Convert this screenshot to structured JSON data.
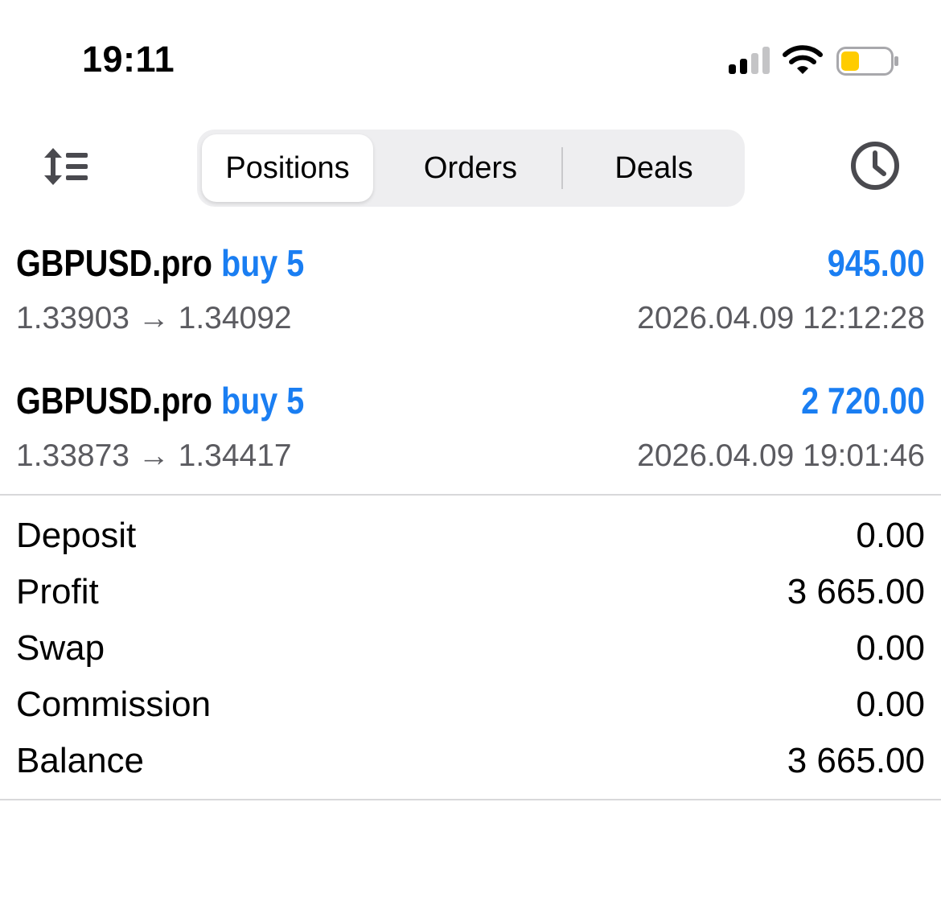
{
  "status_bar": {
    "time": "19:11",
    "icons": [
      "signal-icon",
      "wifi-icon",
      "battery-icon"
    ],
    "battery_color": "#ffcc00"
  },
  "toolbar": {
    "sort_icon": "sort-list-icon",
    "history_icon": "clock-icon",
    "tabs": [
      {
        "label": "Positions",
        "active": true
      },
      {
        "label": "Orders",
        "active": false
      },
      {
        "label": "Deals",
        "active": false
      }
    ]
  },
  "colors": {
    "accent": "#1a7ef2",
    "secondary_text": "#5b5b60"
  },
  "positions": [
    {
      "symbol": "GBPUSD.pro",
      "direction": "buy 5",
      "profit": "945.00",
      "prices": "1.33903 → 1.34092",
      "time": "2026.04.09 12:12:28"
    },
    {
      "symbol": "GBPUSD.pro",
      "direction": "buy 5",
      "profit": "2 720.00",
      "prices": "1.33873 → 1.34417",
      "time": "2026.04.09 19:01:46"
    }
  ],
  "summary": [
    {
      "label": "Deposit",
      "value": "0.00"
    },
    {
      "label": "Profit",
      "value": "3 665.00"
    },
    {
      "label": "Swap",
      "value": "0.00"
    },
    {
      "label": "Commission",
      "value": "0.00"
    },
    {
      "label": "Balance",
      "value": "3 665.00"
    }
  ]
}
